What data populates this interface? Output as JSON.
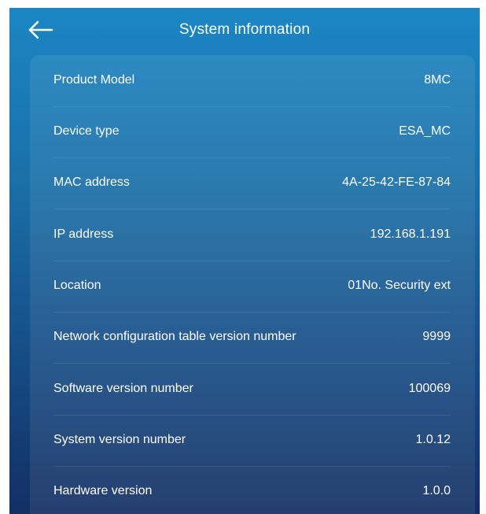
{
  "header": {
    "title": "System information",
    "back_icon": "arrow-left-icon"
  },
  "info": {
    "rows": [
      {
        "label": "Product Model",
        "value": "8MC"
      },
      {
        "label": "Device type",
        "value": "ESA_MC"
      },
      {
        "label": "MAC address",
        "value": "4A-25-42-FE-87-84"
      },
      {
        "label": "IP address",
        "value": "192.168.1.191"
      },
      {
        "label": "Location",
        "value": "01No. Security ext"
      },
      {
        "label": "Network configuration table version number",
        "value": "9999"
      },
      {
        "label": "Software version number",
        "value": "100069"
      },
      {
        "label": "System version number",
        "value": "1.0.12"
      },
      {
        "label": "Hardware version",
        "value": "1.0.0"
      }
    ]
  },
  "colors": {
    "background_top": "#1b86c4",
    "background_bottom": "#132f63",
    "text": "#ffffff"
  }
}
